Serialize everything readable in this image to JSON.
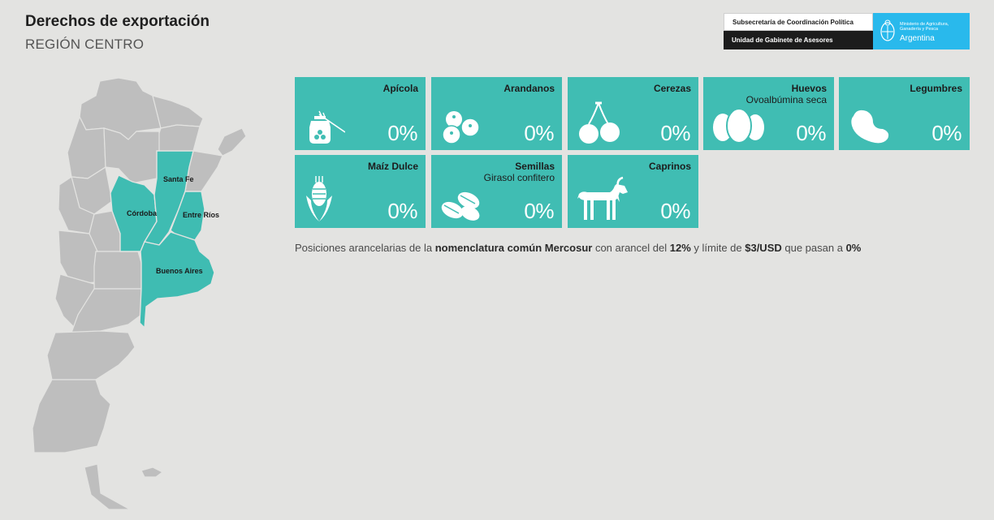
{
  "header": {
    "title": "Derechos de exportación",
    "subtitle": "REGIÓN CENTRO"
  },
  "logo": {
    "line1": "Subsecretaría de Coordinación Política",
    "line2": "Unidad de Gabinete de Asesores",
    "ministry_l1": "Ministerio de Agricultura,",
    "ministry_l2": "Ganadería y Pesca",
    "country": "Argentina"
  },
  "map": {
    "labels": {
      "santa_fe": "Santa Fe",
      "cordoba": "Córdoba",
      "entre_rios": "Entre Ríos",
      "buenos_aires": "Buenos Aires"
    }
  },
  "cards": [
    {
      "name": "Apícola",
      "sub": "",
      "pct": "0%",
      "icon": "honey-jar-icon"
    },
    {
      "name": "Arandanos",
      "sub": "",
      "pct": "0%",
      "icon": "blueberries-icon"
    },
    {
      "name": "Cerezas",
      "sub": "",
      "pct": "0%",
      "icon": "cherries-icon"
    },
    {
      "name": "Huevos",
      "sub": "Ovoalbúmina seca",
      "pct": "0%",
      "icon": "eggs-icon"
    },
    {
      "name": "Legumbres",
      "sub": "",
      "pct": "0%",
      "icon": "bean-icon"
    },
    {
      "name": "Maíz Dulce",
      "sub": "",
      "pct": "0%",
      "icon": "corn-icon"
    },
    {
      "name": "Semillas",
      "sub": "Girasol confitero",
      "pct": "0%",
      "icon": "seeds-icon"
    },
    {
      "name": "Caprinos",
      "sub": "",
      "pct": "0%",
      "icon": "goat-icon"
    }
  ],
  "note": {
    "t1": "Posiciones arancelarias de la ",
    "b1": "nomenclatura común Mercosur",
    "t2": " con arancel del ",
    "b2": "12%",
    "t3": " y límite de ",
    "b3": "$3/USD",
    "t4": " que pasan a ",
    "b4": "0%"
  },
  "colors": {
    "card": "#40bdb3",
    "highlight": "#3fbcb2",
    "map_gray": "#bebebe",
    "background": "#e3e3e1",
    "logo_blue": "#29b9ec"
  }
}
